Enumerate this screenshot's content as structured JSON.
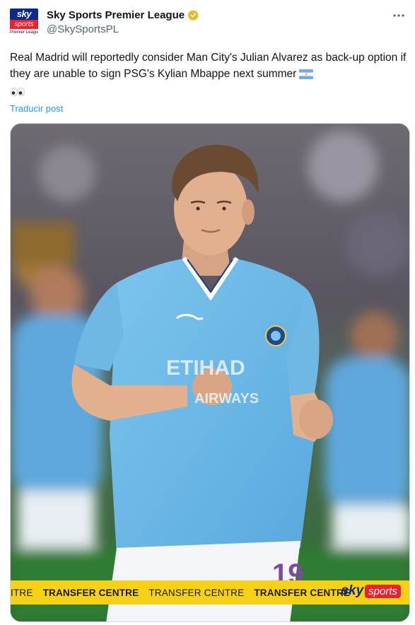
{
  "author": {
    "display_name": "Sky Sports Premier League",
    "handle": "@SkySportsPL",
    "avatar": {
      "line1": "sky",
      "line2": "sports",
      "line3": "Premier League"
    },
    "verified_icon": "gold-verified-badge"
  },
  "more_icon": "ellipsis-icon",
  "tweet": {
    "text": "Real Madrid will reportedly consider Man City's Julian Alvarez as back-up option if they are unable to sign PSG's Kylian Mbappe next summer",
    "flag_icon": "argentina-flag-icon",
    "eyes_icon": "eyes-emoji-icon"
  },
  "translate_label": "Traducir post",
  "media": {
    "banner": {
      "items": [
        "ITRE",
        "TRANSFER CENTRE",
        "TRANSFER CENTRE",
        "TRANSFER CENTRE"
      ],
      "logo_sky": "sky",
      "logo_sports": "sports"
    },
    "shirt_number": "19",
    "colors": {
      "banner": "#f7d117",
      "shirt": "#6cb8e6",
      "accent": "#1d9bf0"
    }
  }
}
